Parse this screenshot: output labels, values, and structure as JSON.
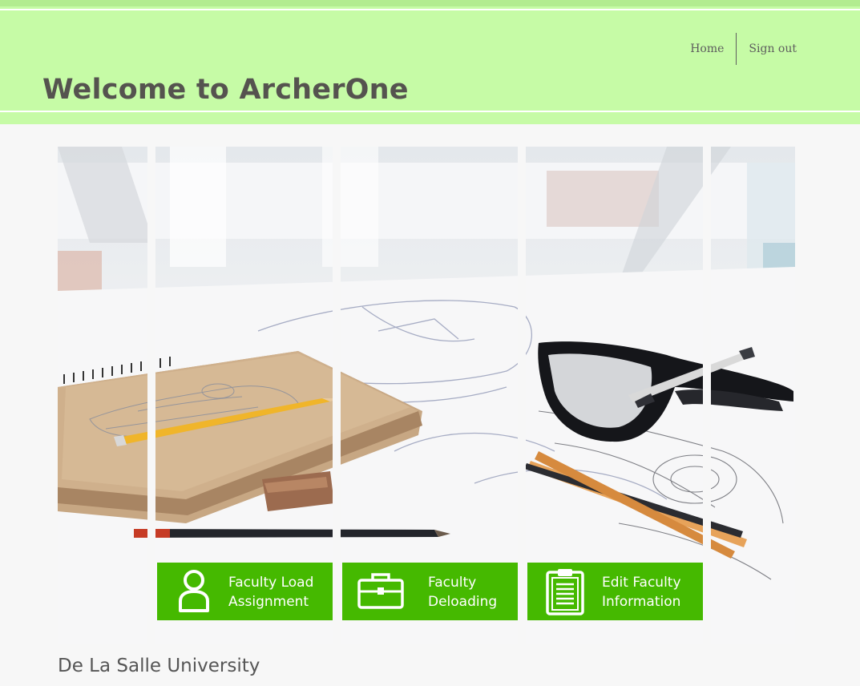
{
  "header": {
    "title": "Welcome to ArcherOne",
    "nav": {
      "home": "Home",
      "sign_out": "Sign out"
    }
  },
  "tiles": [
    {
      "label": "Faculty Load\nAssignment",
      "icon": "user-icon"
    },
    {
      "label": "Faculty\nDeloading",
      "icon": "briefcase-icon"
    },
    {
      "label": "Edit Faculty\nInformation",
      "icon": "clipboard-icon"
    }
  ],
  "footer": {
    "text": "De La Salle University"
  },
  "colors": {
    "header_bg": "#c6fba6",
    "tile_green": "#45b900",
    "page_bg": "#f7f7f7",
    "title_text": "#55534f"
  }
}
